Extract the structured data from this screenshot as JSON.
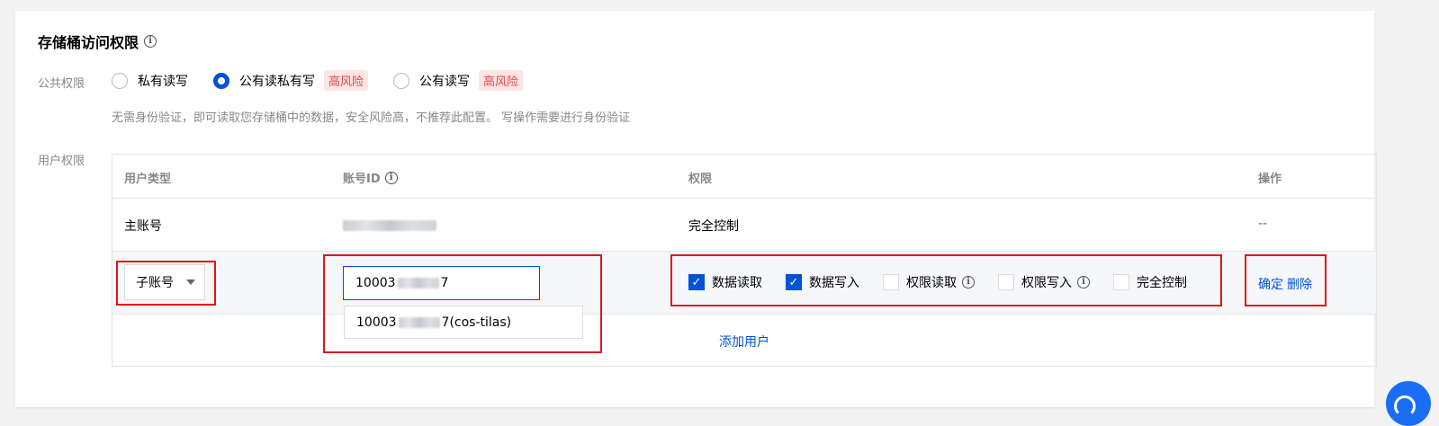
{
  "section": {
    "title": "存储桶访问权限",
    "title_icon": "info-circle-icon"
  },
  "public_access": {
    "label": "公共权限",
    "options": [
      {
        "label": "私有读写",
        "checked": false,
        "risk_tag": ""
      },
      {
        "label": "公有读私有写",
        "checked": true,
        "risk_tag": "高风险"
      },
      {
        "label": "公有读写",
        "checked": false,
        "risk_tag": "高风险"
      }
    ],
    "description": "无需身份验证，即可读取您存储桶中的数据，安全风险高，不推荐此配置。 写操作需要进行身份验证"
  },
  "user_access": {
    "label": "用户权限",
    "columns": {
      "user_type": "用户类型",
      "account_id": "账号ID",
      "permission": "权限",
      "action": "操作"
    },
    "main_row": {
      "user_type": "主账号",
      "permission": "完全控制",
      "action": "--"
    },
    "sub_row": {
      "user_type_select": "子账号",
      "account_prefix": "10003",
      "account_suffix": "7",
      "suggestion_prefix": "10003",
      "suggestion_suffix": "7(cos-tilas)",
      "permissions": [
        {
          "label": "数据读取",
          "checked": true,
          "info": false
        },
        {
          "label": "数据写入",
          "checked": true,
          "info": false
        },
        {
          "label": "权限读取",
          "checked": false,
          "info": true
        },
        {
          "label": "权限写入",
          "checked": false,
          "info": true
        },
        {
          "label": "完全控制",
          "checked": false,
          "info": false
        }
      ],
      "confirm": "确定",
      "delete": "删除"
    },
    "add_user": "添加用户"
  },
  "colors": {
    "accent": "#0052d9",
    "risk": "#e54545",
    "annotation": "#e0141e"
  }
}
